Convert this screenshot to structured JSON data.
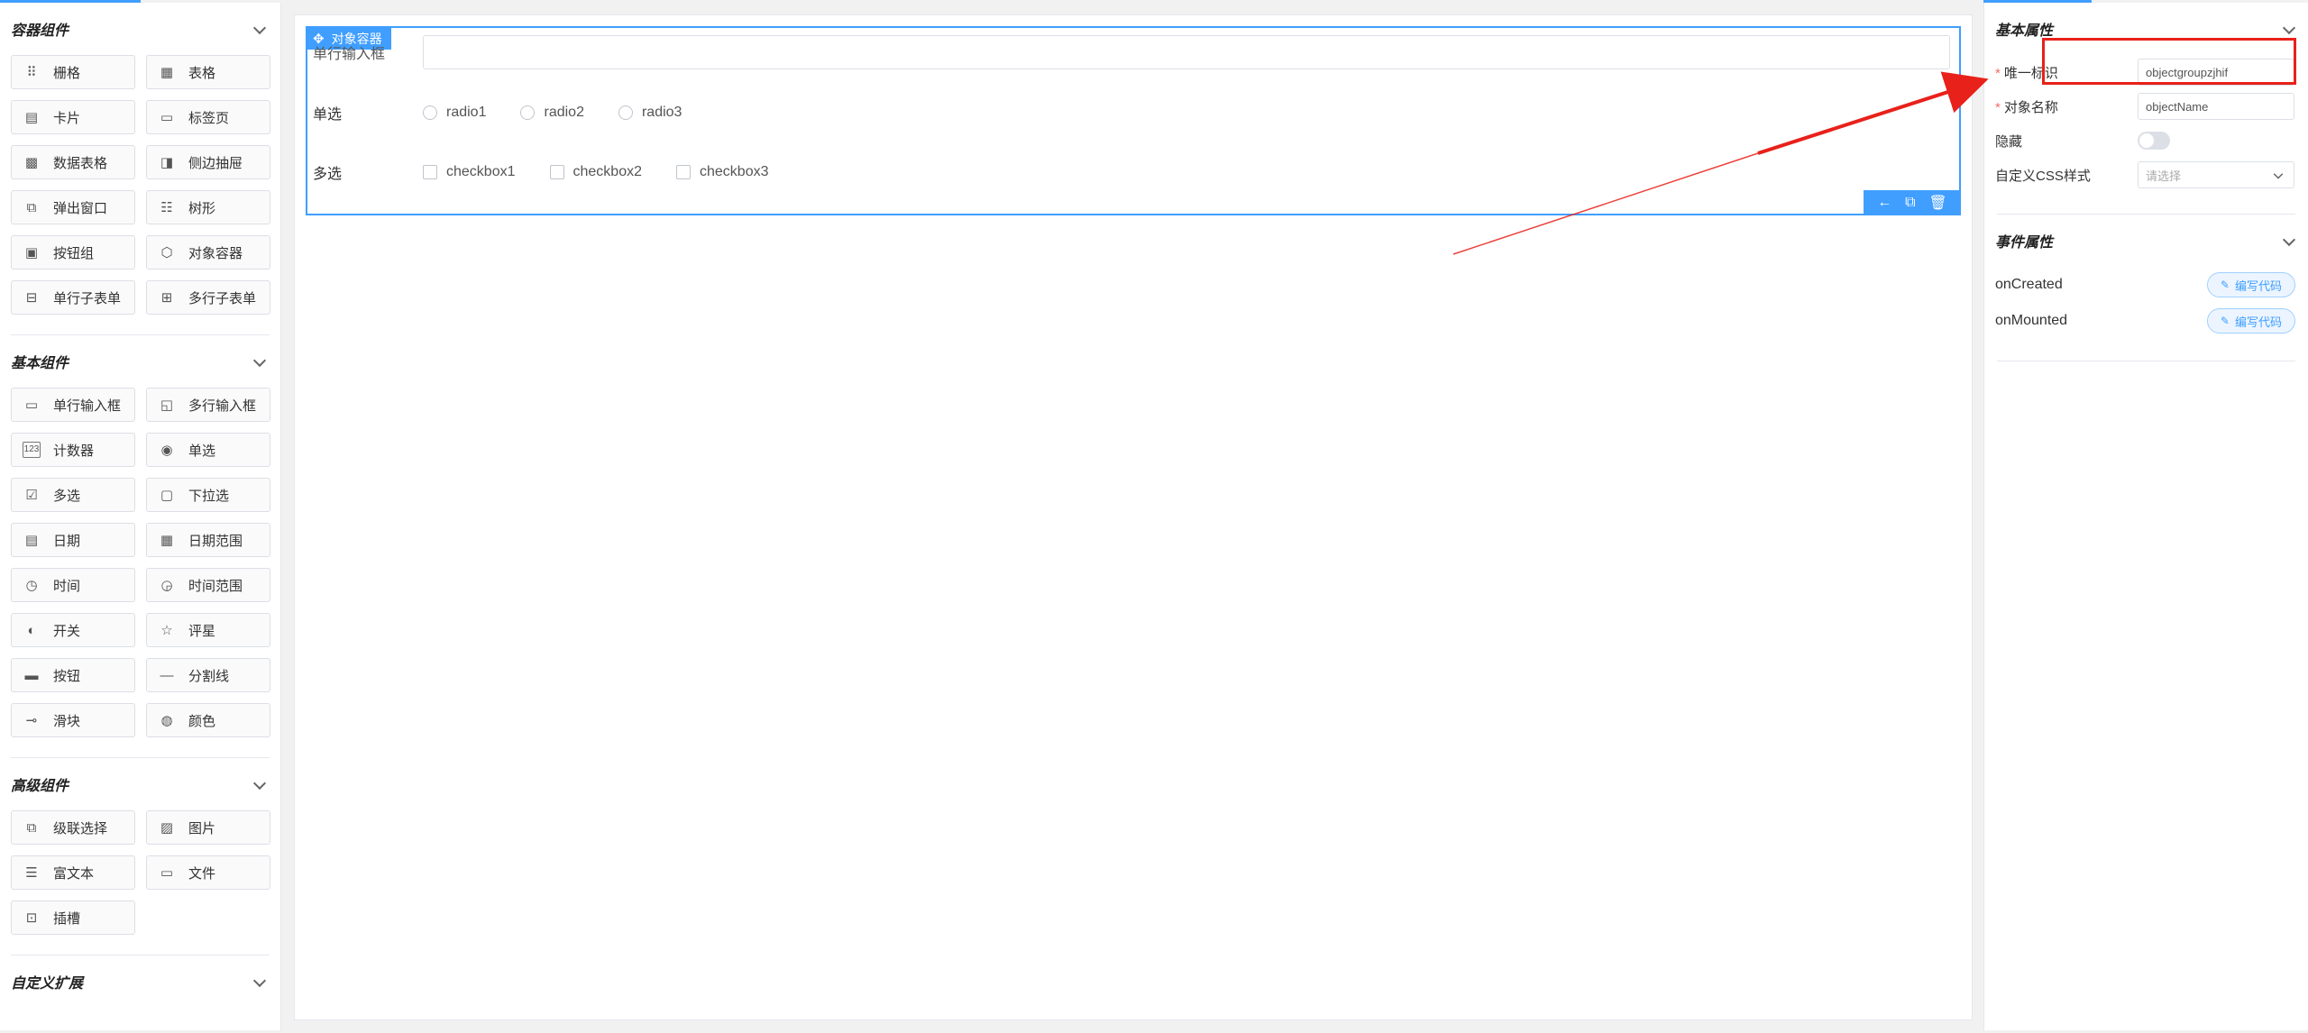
{
  "left_panel": {
    "groups": [
      {
        "title": "容器组件",
        "items": [
          {
            "label": "栅格",
            "icon": "grid-icon"
          },
          {
            "label": "表格",
            "icon": "table-icon"
          },
          {
            "label": "卡片",
            "icon": "card-icon"
          },
          {
            "label": "标签页",
            "icon": "tabs-icon"
          },
          {
            "label": "数据表格",
            "icon": "data-table-icon"
          },
          {
            "label": "侧边抽屉",
            "icon": "drawer-icon"
          },
          {
            "label": "弹出窗口",
            "icon": "dialog-icon"
          },
          {
            "label": "树形",
            "icon": "tree-icon"
          },
          {
            "label": "按钮组",
            "icon": "button-group-icon"
          },
          {
            "label": "对象容器",
            "icon": "object-container-icon"
          },
          {
            "label": "单行子表单",
            "icon": "single-subform-icon"
          },
          {
            "label": "多行子表单",
            "icon": "multi-subform-icon"
          }
        ]
      },
      {
        "title": "基本组件",
        "items": [
          {
            "label": "单行输入框",
            "icon": "input-icon"
          },
          {
            "label": "多行输入框",
            "icon": "textarea-icon"
          },
          {
            "label": "计数器",
            "icon": "number-icon"
          },
          {
            "label": "单选",
            "icon": "radio-icon"
          },
          {
            "label": "多选",
            "icon": "checkbox-icon"
          },
          {
            "label": "下拉选",
            "icon": "select-icon"
          },
          {
            "label": "日期",
            "icon": "date-icon"
          },
          {
            "label": "日期范围",
            "icon": "date-range-icon"
          },
          {
            "label": "时间",
            "icon": "time-icon"
          },
          {
            "label": "时间范围",
            "icon": "time-range-icon"
          },
          {
            "label": "开关",
            "icon": "switch-icon"
          },
          {
            "label": "评星",
            "icon": "star-icon"
          },
          {
            "label": "按钮",
            "icon": "button-icon"
          },
          {
            "label": "分割线",
            "icon": "divider-icon"
          },
          {
            "label": "滑块",
            "icon": "slider-icon"
          },
          {
            "label": "颜色",
            "icon": "color-icon"
          }
        ]
      },
      {
        "title": "高级组件",
        "items": [
          {
            "label": "级联选择",
            "icon": "cascader-icon"
          },
          {
            "label": "图片",
            "icon": "picture-icon"
          },
          {
            "label": "富文本",
            "icon": "rich-text-icon"
          },
          {
            "label": "文件",
            "icon": "file-icon"
          },
          {
            "label": "插槽",
            "icon": "slot-icon"
          }
        ]
      },
      {
        "title": "自定义扩展",
        "items": []
      }
    ]
  },
  "canvas": {
    "container_tag": "对象容器",
    "text_field_label": "单行输入框",
    "radio_label": "单选",
    "radio_options": [
      "radio1",
      "radio2",
      "radio3"
    ],
    "checkbox_label": "多选",
    "checkbox_options": [
      "checkbox1",
      "checkbox2",
      "checkbox3"
    ]
  },
  "right_panel": {
    "basic_title": "基本属性",
    "unique_id_label": "唯一标识",
    "unique_id_value": "objectgroupzjhif",
    "object_name_label": "对象名称",
    "object_name_value": "objectName",
    "hidden_label": "隐藏",
    "css_label": "自定义CSS样式",
    "css_placeholder": "请选择",
    "event_title": "事件属性",
    "events": [
      {
        "name": "onCreated",
        "button": "编写代码"
      },
      {
        "name": "onMounted",
        "button": "编写代码"
      }
    ]
  },
  "colors": {
    "accent": "#409eff",
    "annotation": "#e8211a"
  }
}
